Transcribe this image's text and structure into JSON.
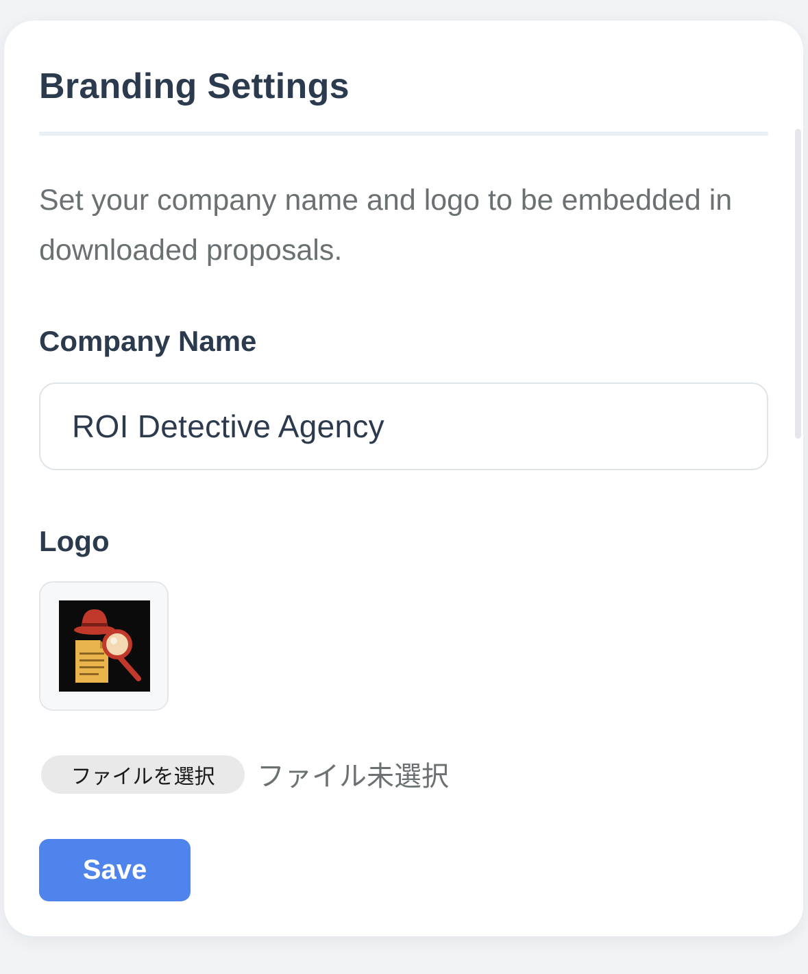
{
  "panel": {
    "title": "Branding Settings",
    "description": "Set your company name and logo to be embedded in downloaded proposals."
  },
  "company_name": {
    "label": "Company Name",
    "value": "ROI Detective Agency"
  },
  "logo": {
    "label": "Logo",
    "icon": "detective-logo-icon"
  },
  "file_picker": {
    "button_label": "ファイルを選択",
    "status": "ファイル未選択"
  },
  "actions": {
    "save_label": "Save"
  },
  "colors": {
    "accent": "#4f84ec",
    "heading": "#2c3a4d",
    "muted_text": "#6b7072",
    "logo_hat": "#c0392b",
    "logo_document": "#e9b44c"
  }
}
